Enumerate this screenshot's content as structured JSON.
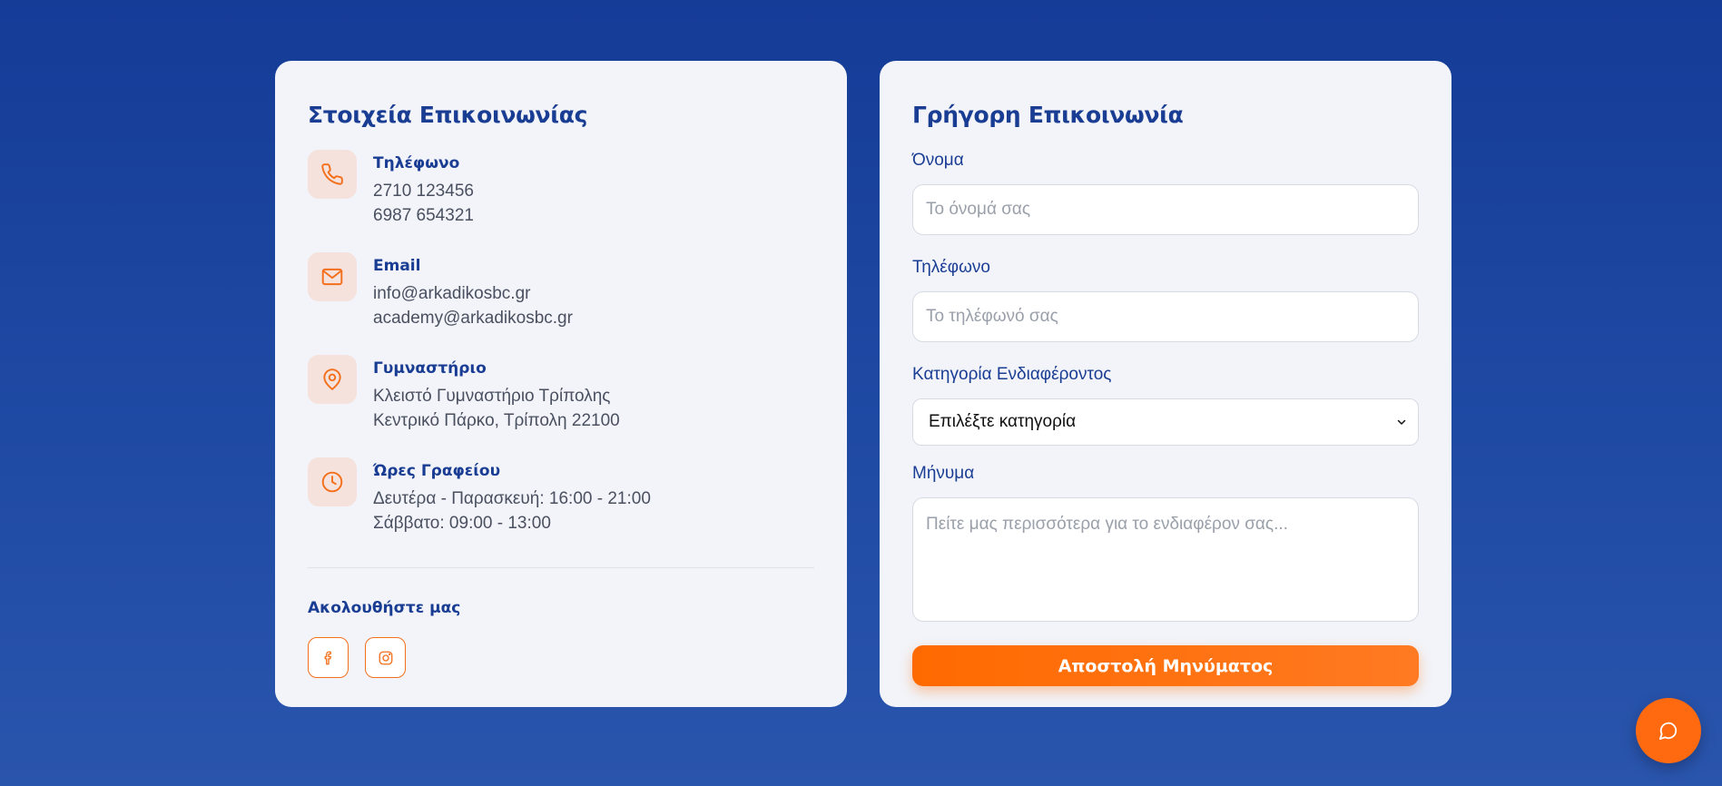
{
  "contact_info": {
    "title": "Στοιχεία Επικοινωνίας",
    "items": [
      {
        "icon": "phone-icon",
        "label": "Τηλέφωνο",
        "lines": [
          "2710 123456",
          "6987 654321"
        ]
      },
      {
        "icon": "mail-icon",
        "label": "Email",
        "lines": [
          "info@arkadikosbc.gr",
          "academy@arkadikosbc.gr"
        ]
      },
      {
        "icon": "map-pin-icon",
        "label": "Γυμναστήριο",
        "lines": [
          "Κλειστό Γυμναστήριο Τρίπολης",
          "Κεντρικό Πάρκο, Τρίπολη 22100"
        ]
      },
      {
        "icon": "clock-icon",
        "label": "Ώρες Γραφείου",
        "lines": [
          "Δευτέρα - Παρασκευή: 16:00 - 21:00",
          "Σάββατο: 09:00 - 13:00"
        ]
      }
    ],
    "follow_title": "Ακολουθήστε μας",
    "social": [
      {
        "icon": "facebook-icon"
      },
      {
        "icon": "instagram-icon"
      }
    ]
  },
  "quick_contact": {
    "title": "Γρήγορη Επικοινωνία",
    "name_label": "Όνομα",
    "name_placeholder": "Το όνομά σας",
    "phone_label": "Τηλέφωνο",
    "phone_placeholder": "Το τηλέφωνό σας",
    "category_label": "Κατηγορία Ενδιαφέροντος",
    "category_selected": "Επιλέξτε κατηγορία",
    "message_label": "Μήνυμα",
    "message_placeholder": "Πείτε μας περισσότερα για το ενδιαφέρον σας...",
    "submit_label": "Αποστολή Μηνύματος"
  },
  "chat_button": {
    "icon": "chat-bubble-icon"
  },
  "colors": {
    "accent": "#ff6a00",
    "brand": "#1a3d94",
    "icon_bg": "#f6e2dc",
    "background": "#1f4aa4"
  }
}
